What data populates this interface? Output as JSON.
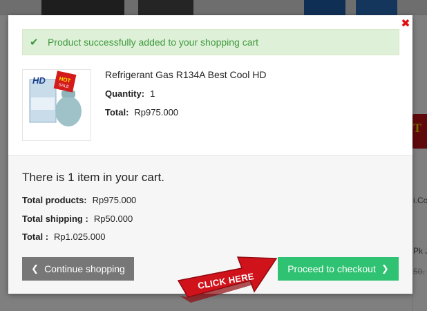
{
  "background": {
    "fragments": [
      "i.Co",
      "Pk J",
      "50."
    ]
  },
  "modal": {
    "close_icon": "close-icon",
    "alert": {
      "icon": "check-icon",
      "message": "Product successfully added to your shopping cart"
    },
    "product": {
      "image_badge_text": "HOT",
      "image_badge_subtext": "SALE",
      "image_brand_text": "HD",
      "name": "Refrigerant Gas R134A Best Cool HD",
      "quantity_label": "Quantity:",
      "quantity_value": "1",
      "total_label": "Total:",
      "total_value": "Rp975.000"
    },
    "summary": {
      "items_text": "There is 1 item in your cart.",
      "total_products_label": "Total products:",
      "total_products_value": "Rp975.000",
      "total_shipping_label": "Total shipping :",
      "total_shipping_value": "Rp50.000",
      "total_label": "Total :",
      "total_value": "Rp1.025.000"
    },
    "buttons": {
      "continue_label": "Continue shopping",
      "checkout_label": "Proceed to checkout"
    },
    "annotation": {
      "click_here": "CLICK HERE"
    }
  },
  "colors": {
    "success_bg": "#dff0d8",
    "success_text": "#3c9a3c",
    "checkout_green": "#2fc272",
    "continue_gray": "#777777",
    "close_red": "#e30d0d",
    "arrow_red": "#d0121b"
  }
}
